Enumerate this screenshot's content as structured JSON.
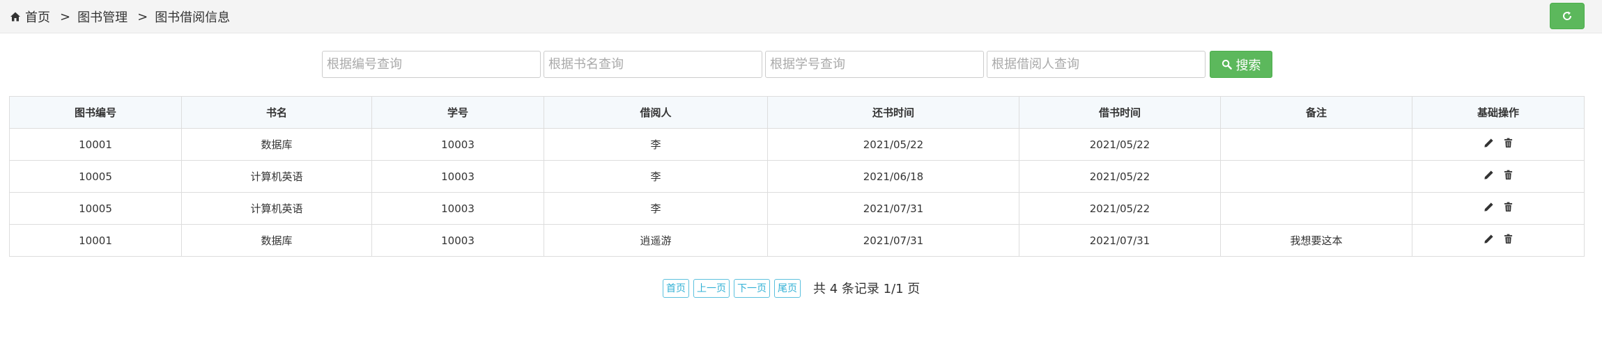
{
  "breadcrumb": {
    "home": "首页",
    "sep": ">",
    "section": "图书管理",
    "current": "图书借阅信息"
  },
  "icons": {
    "home": "home-icon",
    "refresh": "refresh-icon",
    "search": "search-icon",
    "edit": "pencil-icon",
    "delete": "trash-icon"
  },
  "colors": {
    "primary_green": "#5cb85c",
    "pager_blue": "#31b0d5",
    "header_bg": "#f5f9fc"
  },
  "search": {
    "id_placeholder": "根据编号查询",
    "title_placeholder": "根据书名查询",
    "student_placeholder": "根据学号查询",
    "borrower_placeholder": "根据借阅人查询",
    "button_label": "搜索"
  },
  "table": {
    "headers": [
      "图书编号",
      "书名",
      "学号",
      "借阅人",
      "还书时间",
      "借书时间",
      "备注",
      "基础操作"
    ],
    "rows": [
      [
        "10001",
        "数据库",
        "10003",
        "李",
        "2021/05/22",
        "2021/05/22",
        ""
      ],
      [
        "10005",
        "计算机英语",
        "10003",
        "李",
        "2021/06/18",
        "2021/05/22",
        ""
      ],
      [
        "10005",
        "计算机英语",
        "10003",
        "李",
        "2021/07/31",
        "2021/05/22",
        ""
      ],
      [
        "10001",
        "数据库",
        "10003",
        "逍遥游",
        "2021/07/31",
        "2021/07/31",
        "我想要这本"
      ]
    ]
  },
  "pager": {
    "first": "首页",
    "prev": "上一页",
    "next": "下一页",
    "last": "尾页",
    "info": "共 4 条记录 1/1 页"
  }
}
